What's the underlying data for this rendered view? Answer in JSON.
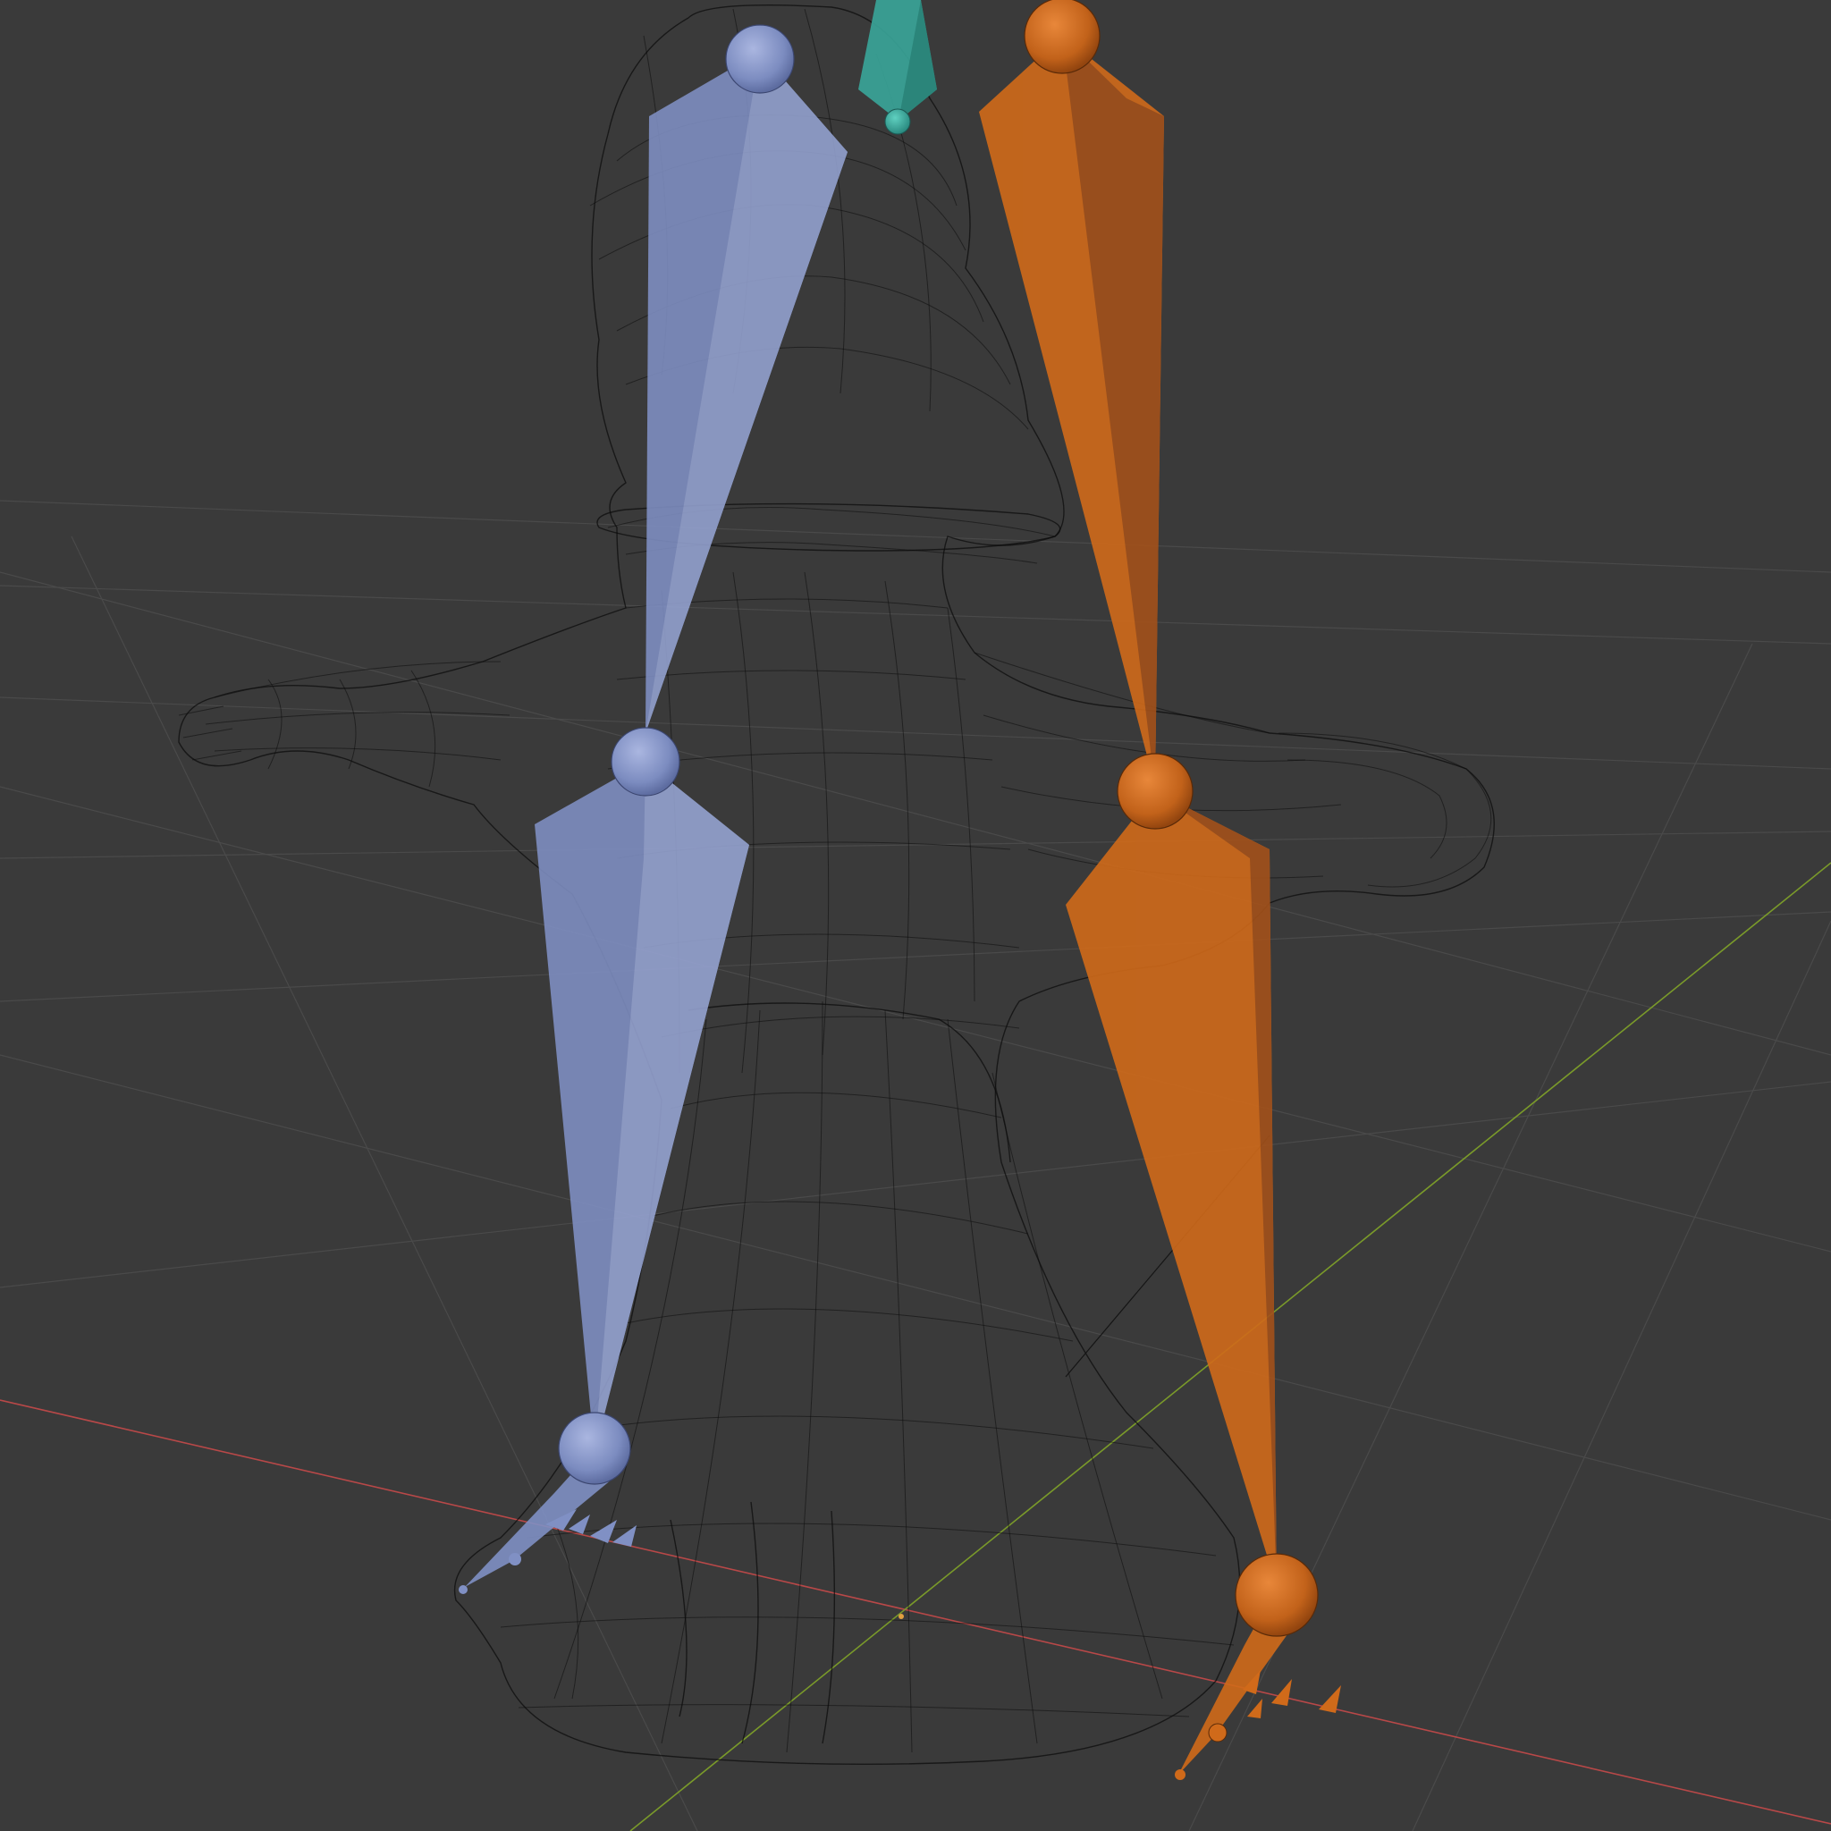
{
  "viewport": {
    "background": "#3a3a3a",
    "grid_color": "#4a4a4a",
    "x_axis_color": "#b84848",
    "y_axis_color": "#7a9a2a"
  },
  "object": {
    "mesh_display": "wireframe",
    "armature_display": "octahedral"
  },
  "bones": {
    "left_leg_color": "#8090c4",
    "right_leg_color": "#d06a1a",
    "root_color": "#3aa69a"
  }
}
